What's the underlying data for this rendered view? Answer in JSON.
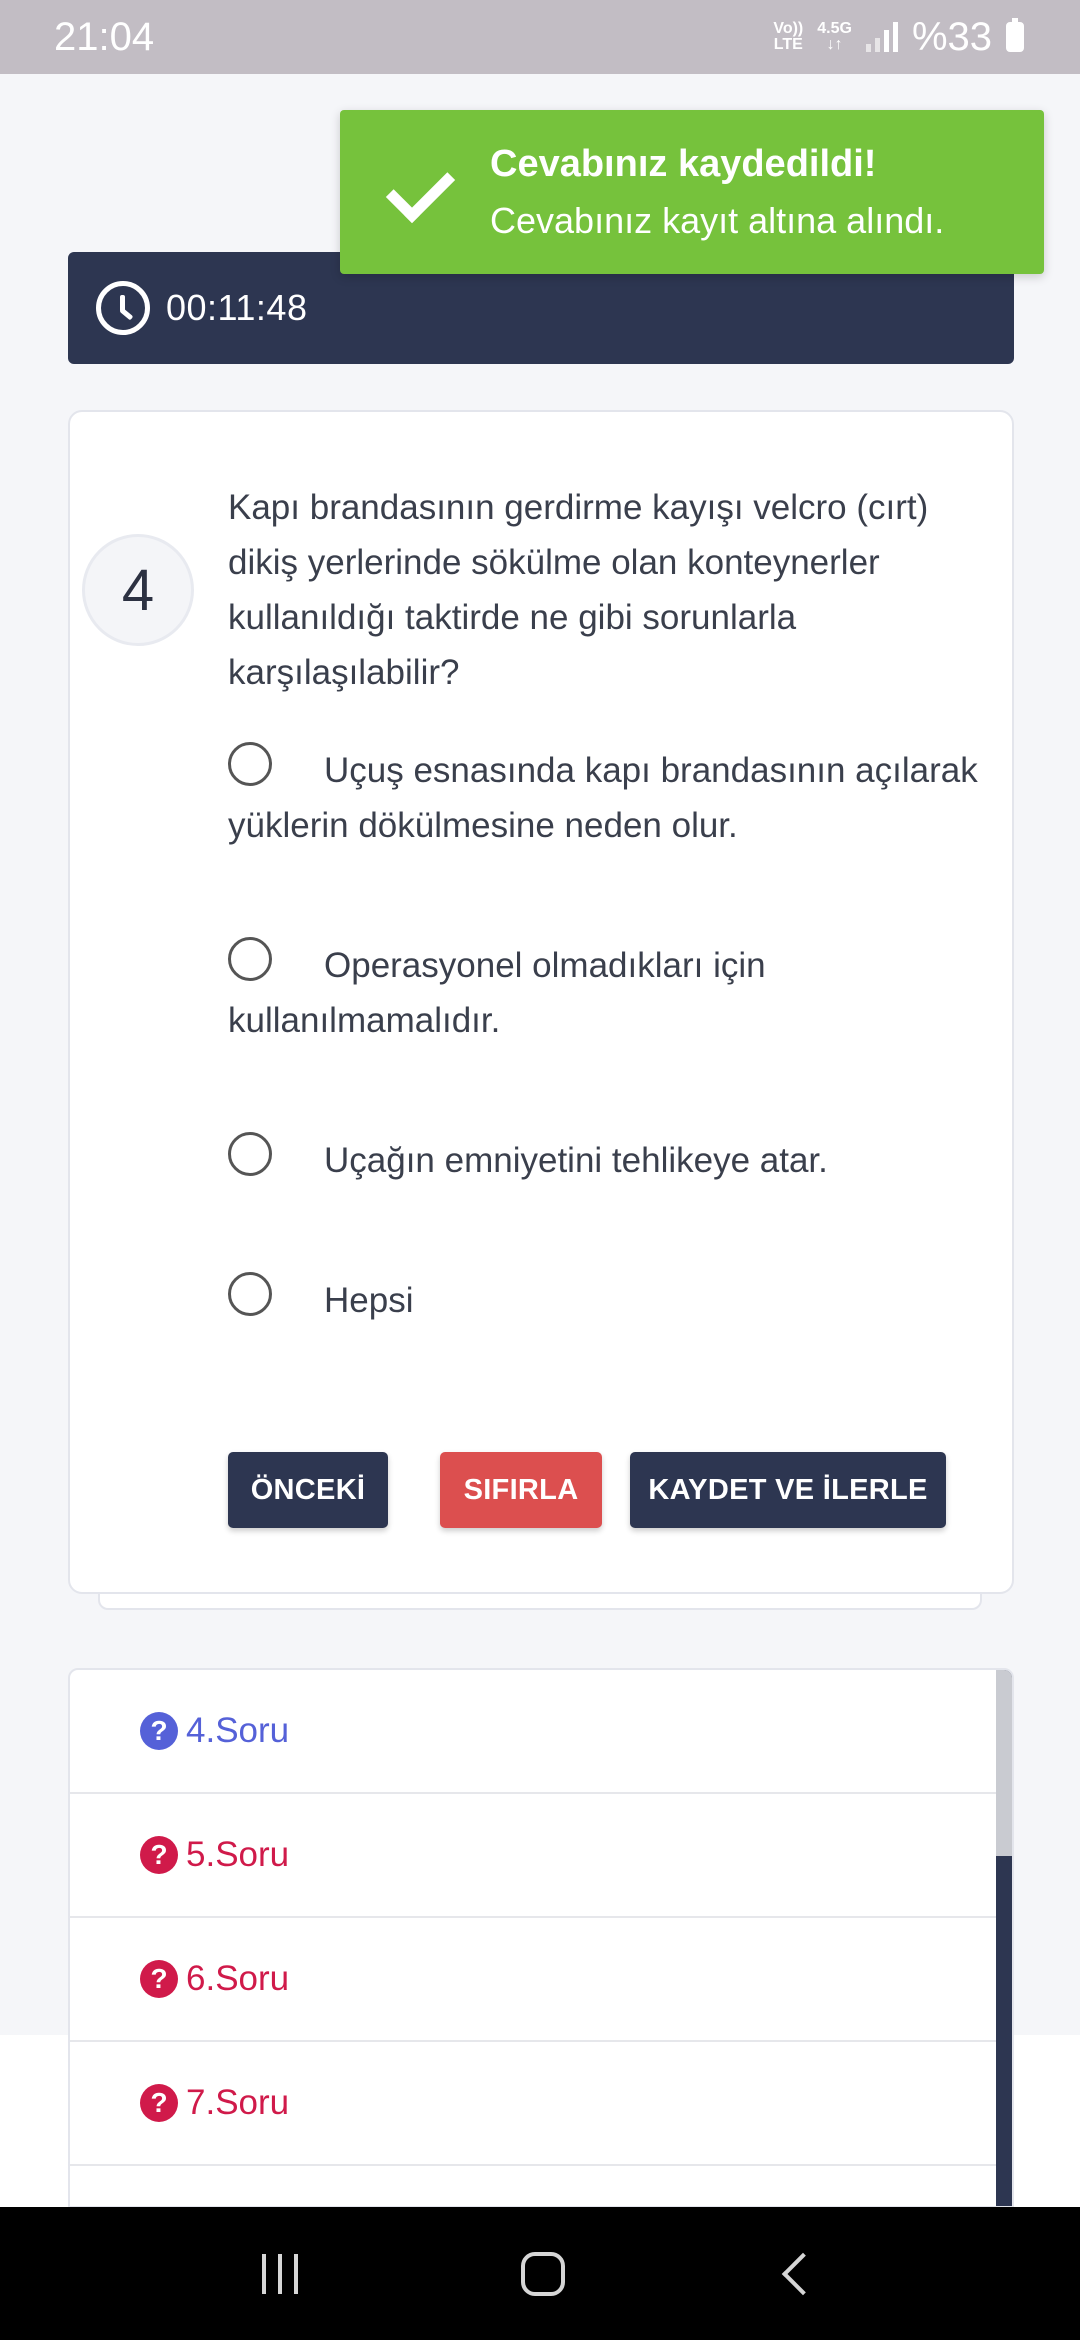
{
  "status_bar": {
    "time": "21:04",
    "network_top": "Vo))",
    "network_bottom": "LTE",
    "data_type": "4.5G",
    "battery": "%33"
  },
  "toast": {
    "title": "Cevabınız kaydedildi!",
    "message": "Cevabınız kayıt altına alındı."
  },
  "timer": {
    "value": "00:11:48"
  },
  "question": {
    "number": "4",
    "text": "Kapı brandasının gerdirme kayışı velcro (cırt) dikiş yerlerinde sökülme olan konteynerler kullanıldığı taktirde ne gibi sorunlarla karşılaşılabilir?",
    "options": [
      {
        "label": "Uçuş esnasında kapı brandasının açılarak yüklerin dökülmesine neden olur."
      },
      {
        "label": "Operasyonel olmadıkları için kullanılmamalıdır."
      },
      {
        "label": "Uçağın emniyetini tehlikeye atar."
      },
      {
        "label": "Hepsi"
      }
    ]
  },
  "buttons": {
    "prev": "ÖNCEKİ",
    "reset": "SIFIRLA",
    "save_next": "KAYDET VE İLERLE"
  },
  "question_list": [
    {
      "label": "4.Soru"
    },
    {
      "label": "5.Soru"
    },
    {
      "label": "6.Soru"
    },
    {
      "label": "7.Soru"
    }
  ],
  "colors": {
    "navy": "#2d3651",
    "success": "#76c23c",
    "danger": "#dc4f4f",
    "current": "#5561d8",
    "pending": "#d01a4a"
  }
}
